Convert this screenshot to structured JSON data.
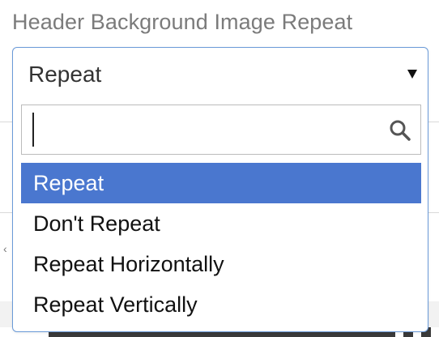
{
  "field": {
    "label": "Header Background Image Repeat"
  },
  "select": {
    "selected_value": "Repeat",
    "arrow_icon": "triangle-down-icon",
    "search": {
      "value": "",
      "placeholder": "",
      "icon": "search-icon"
    },
    "options": [
      {
        "label": "Repeat",
        "highlighted": true
      },
      {
        "label": "Don't Repeat",
        "highlighted": false
      },
      {
        "label": "Repeat Horizontally",
        "highlighted": false
      },
      {
        "label": "Repeat Vertically",
        "highlighted": false
      }
    ]
  },
  "colors": {
    "highlight": "#4a77cf",
    "focus_border": "#6a9ad8",
    "label_text": "#7b7b7b"
  }
}
